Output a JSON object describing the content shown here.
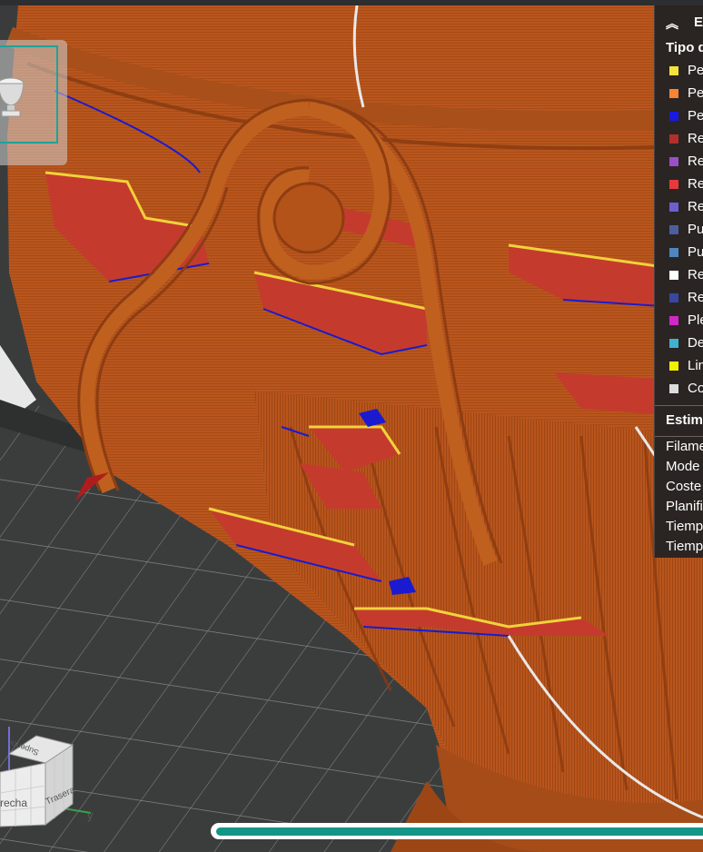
{
  "legend": {
    "header_label": "E",
    "section_title": "Tipo d",
    "items": [
      {
        "label": "Pe",
        "color": "#f5e33b"
      },
      {
        "label": "Pe",
        "color": "#f98433"
      },
      {
        "label": "Pe",
        "color": "#1919e0"
      },
      {
        "label": "Re",
        "color": "#b2302b"
      },
      {
        "label": "Re",
        "color": "#9a4ec8"
      },
      {
        "label": "Re",
        "color": "#e8393a"
      },
      {
        "label": "Re",
        "color": "#6d5fd0"
      },
      {
        "label": "Pu",
        "color": "#4d5ea0"
      },
      {
        "label": "Pu",
        "color": "#4d86c1"
      },
      {
        "label": "Re",
        "color": "#ffffff"
      },
      {
        "label": "Re",
        "color": "#3946a3"
      },
      {
        "label": "Ple",
        "color": "#d227c8"
      },
      {
        "label": "De",
        "color": "#3fb2cf"
      },
      {
        "label": "Lin",
        "color": "#f0f000"
      },
      {
        "label": "Co",
        "color": "#dcdcdc"
      }
    ],
    "estimation_title": "Estim",
    "estimation_rows": [
      "Filame",
      "Mode",
      "Coste",
      "Planifi",
      "Tiemp",
      "Tiemp"
    ]
  },
  "viewcube": {
    "top_label": "Superior",
    "right_label": "Trasera",
    "left_label": "recha",
    "axis_y_label": "y"
  },
  "colors": {
    "model": "#b9561d",
    "model_dark": "#8e3d12",
    "infill_red": "#c43b2e",
    "perimeter_yellow": "#f2d23a",
    "accent": "#159587"
  },
  "icons": {
    "collapse": "chevron-up-double-icon",
    "thumbnail": "urn-thumbnail-icon"
  },
  "slider": {
    "progress": 1.0
  }
}
